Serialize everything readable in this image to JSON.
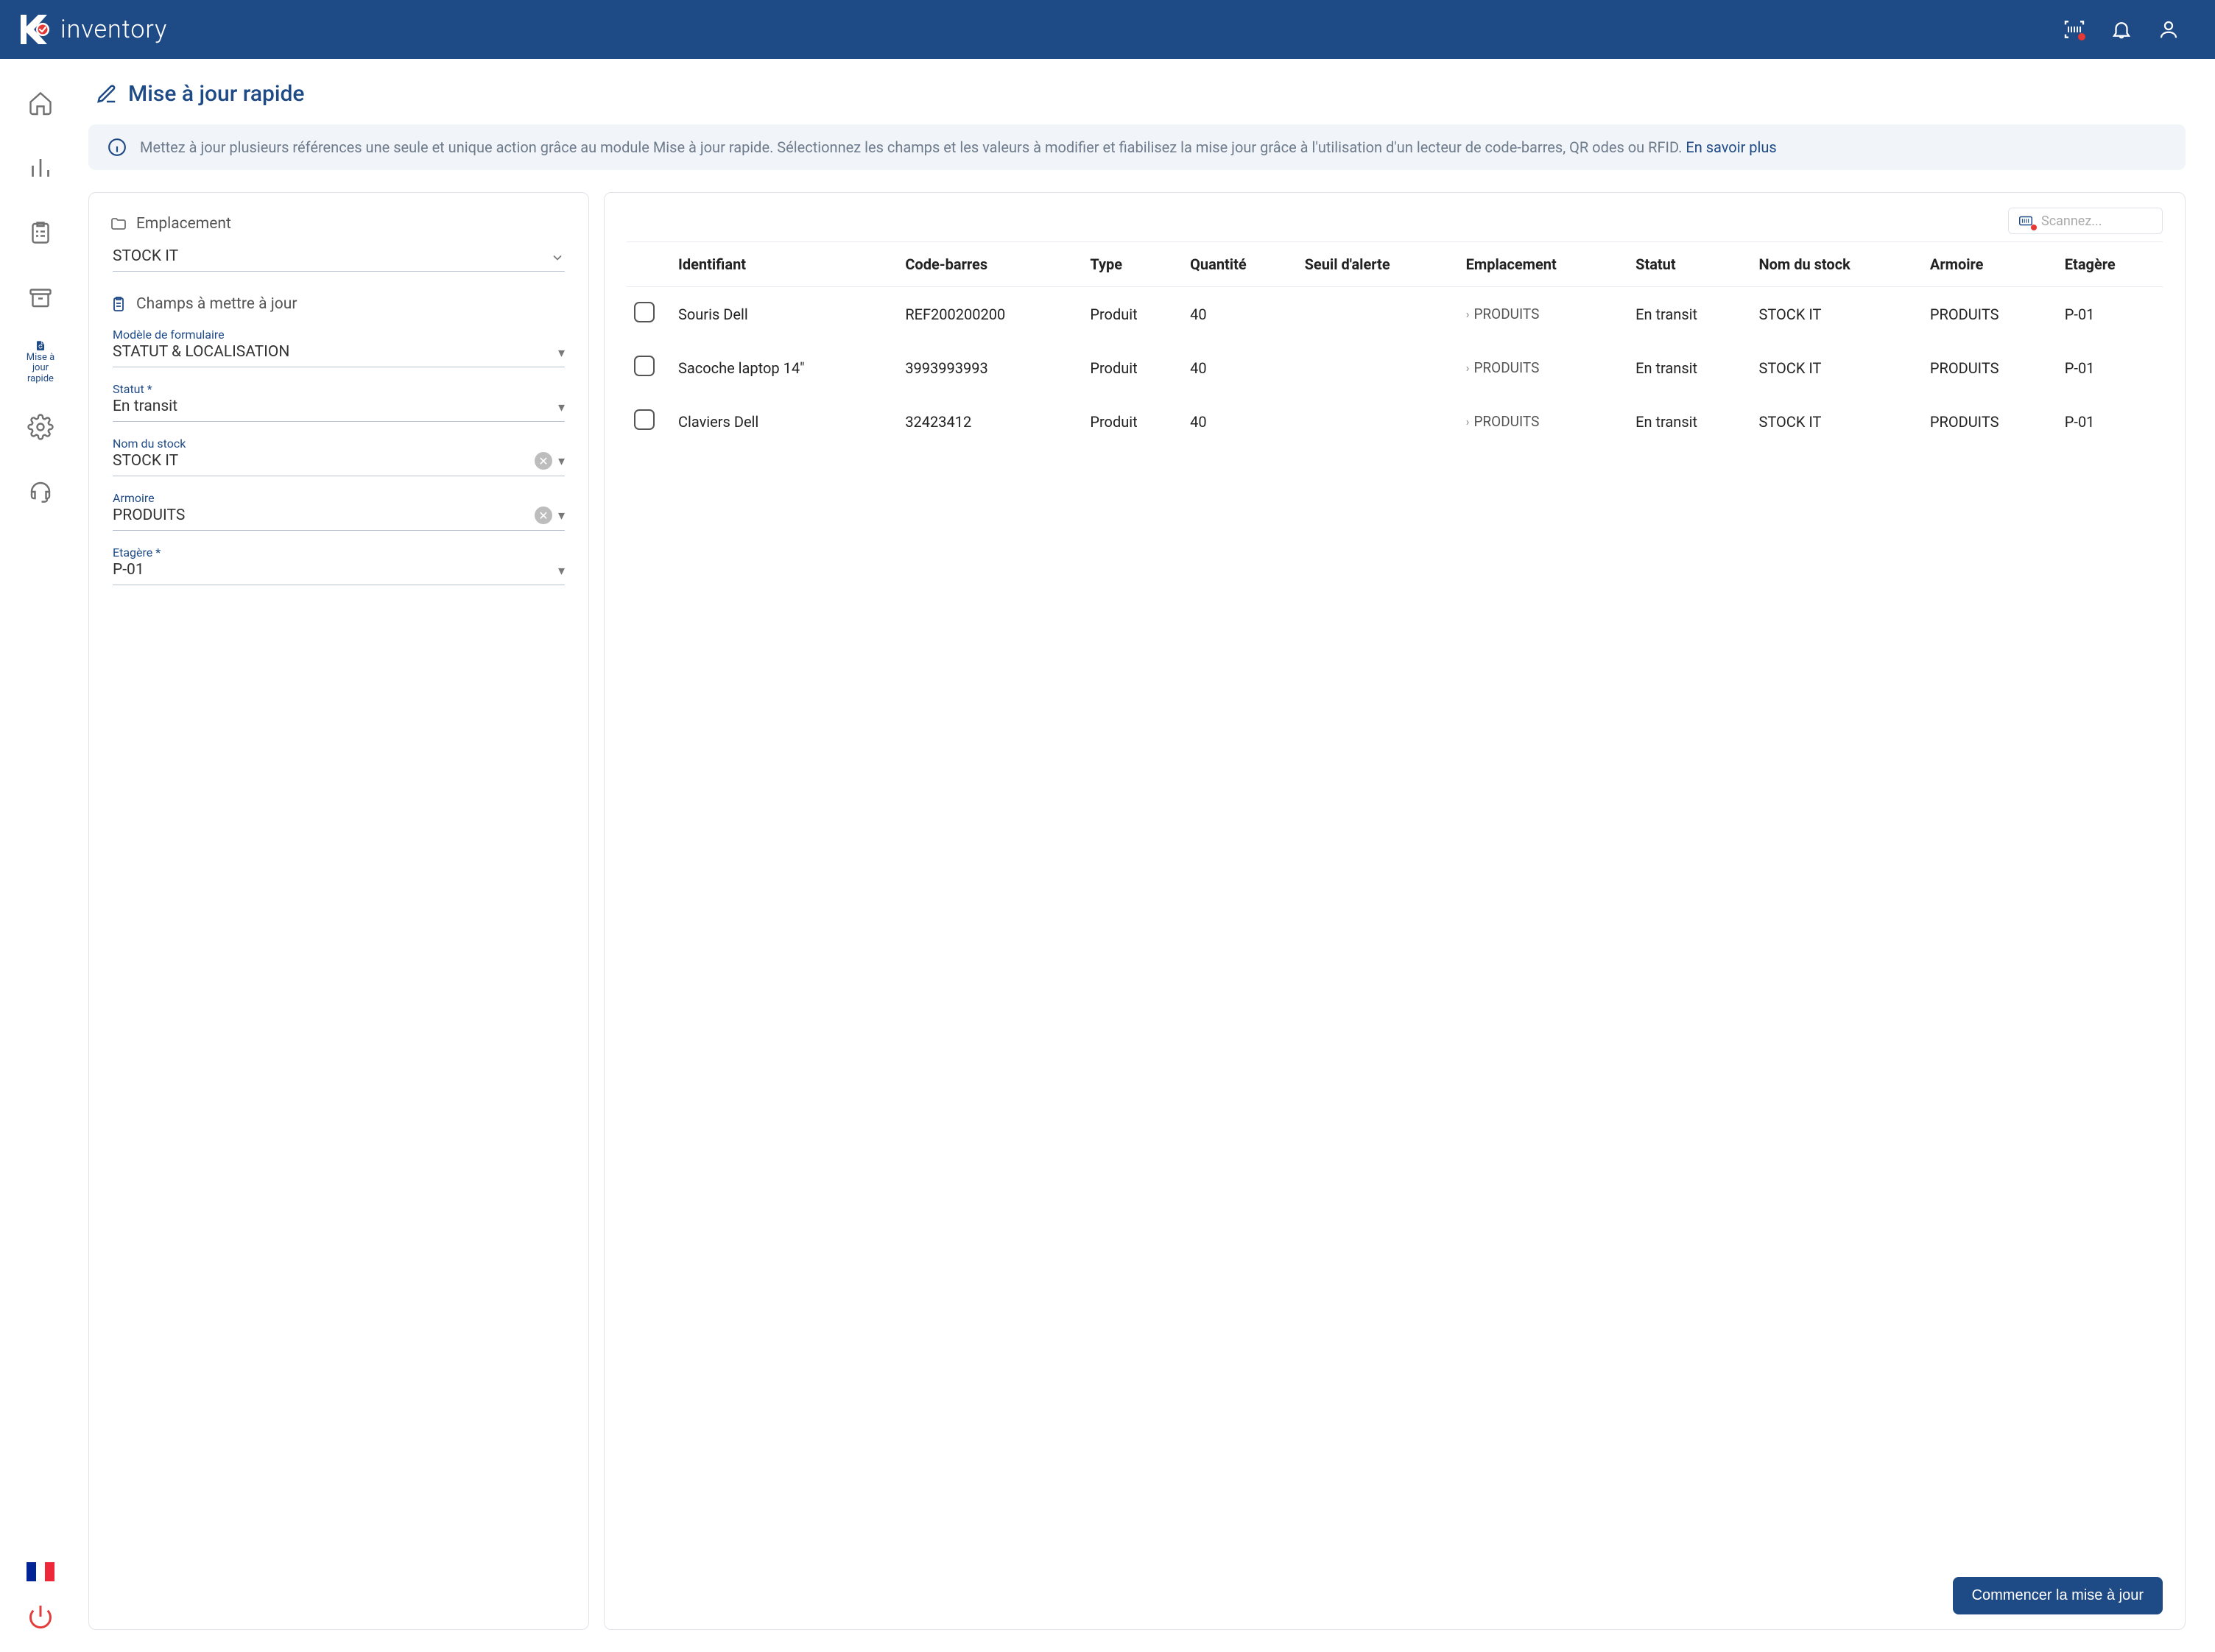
{
  "header": {
    "brand_text": "inventory"
  },
  "sidebar": {
    "active_label_line1": "Mise à jour",
    "active_label_line2": "rapide"
  },
  "page": {
    "title": "Mise à jour rapide",
    "info_text": "Mettez à jour plusieurs références une seule et unique action grâce au module Mise à jour rapide. Sélectionnez les champs et les valeurs à modifier et fiabilisez la mise jour grâce à l'utilisation d'un lecteur de code-barres, QR odes ou RFID.",
    "info_link": "En savoir plus"
  },
  "left_panel": {
    "section_location": "Emplacement",
    "location_value": "STOCK IT",
    "section_fields": "Champs à mettre à jour",
    "template_label": "Modèle de formulaire",
    "template_value": "STATUT & LOCALISATION",
    "status_label": "Statut *",
    "status_value": "En transit",
    "stock_label": "Nom du stock",
    "stock_value": "STOCK IT",
    "cabinet_label": "Armoire",
    "cabinet_value": "PRODUITS",
    "shelf_label": "Etagère *",
    "shelf_value": "P-01"
  },
  "table": {
    "scan_placeholder": "Scannez...",
    "headers": {
      "identifier": "Identifiant",
      "barcode": "Code-barres",
      "type": "Type",
      "quantity": "Quantité",
      "threshold": "Seuil d'alerte",
      "location": "Emplacement",
      "status": "Statut",
      "stock_name": "Nom du stock",
      "cabinet": "Armoire",
      "shelf": "Etagère"
    },
    "rows": [
      {
        "identifier": "Souris Dell",
        "barcode": "REF200200200",
        "type": "Produit",
        "quantity": "40",
        "threshold": "",
        "location": "PRODUITS",
        "status": "En transit",
        "stock_name": "STOCK IT",
        "cabinet": "PRODUITS",
        "shelf": "P-01"
      },
      {
        "identifier": "Sacoche laptop 14\"",
        "barcode": "3993993993",
        "type": "Produit",
        "quantity": "40",
        "threshold": "",
        "location": "PRODUITS",
        "status": "En transit",
        "stock_name": "STOCK IT",
        "cabinet": "PRODUITS",
        "shelf": "P-01"
      },
      {
        "identifier": "Claviers Dell",
        "barcode": "32423412",
        "type": "Produit",
        "quantity": "40",
        "threshold": "",
        "location": "PRODUITS",
        "status": "En transit",
        "stock_name": "STOCK IT",
        "cabinet": "PRODUITS",
        "shelf": "P-01"
      }
    ]
  },
  "actions": {
    "start_update": "Commencer la mise à jour"
  }
}
